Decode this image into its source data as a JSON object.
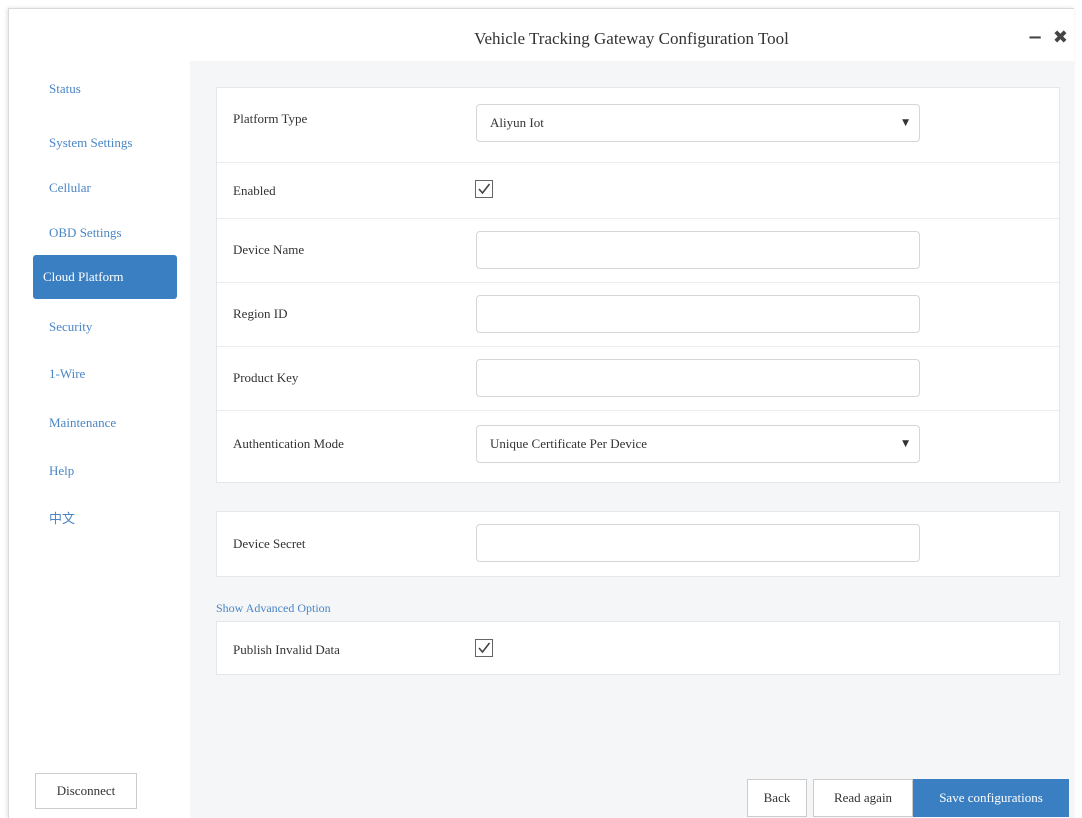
{
  "window": {
    "title": "Vehicle Tracking Gateway Configuration Tool",
    "minimize": "−",
    "close": "✖"
  },
  "sidebar": {
    "items": [
      {
        "label": "Status",
        "active": false
      },
      {
        "label": "System Settings",
        "active": false
      },
      {
        "label": "Cellular",
        "active": false
      },
      {
        "label": "OBD Settings",
        "active": false
      },
      {
        "label": "Cloud Platform",
        "active": true
      },
      {
        "label": "Security",
        "active": false
      },
      {
        "label": "1-Wire",
        "active": false
      },
      {
        "label": "Maintenance",
        "active": false
      },
      {
        "label": "Help",
        "active": false
      },
      {
        "label": "中文",
        "active": false
      }
    ],
    "disconnect_label": "Disconnect"
  },
  "form": {
    "platform_type": {
      "label": "Platform Type",
      "value": "Aliyun Iot"
    },
    "enabled": {
      "label": "Enabled",
      "checked": true
    },
    "device_name": {
      "label": "Device Name",
      "value": ""
    },
    "region_id": {
      "label": "Region ID",
      "value": ""
    },
    "product_key": {
      "label": "Product Key",
      "value": ""
    },
    "auth_mode": {
      "label": "Authentication Mode",
      "value": "Unique Certificate Per Device"
    },
    "device_secret": {
      "label": "Device Secret",
      "value": ""
    },
    "advanced_link": "Show Advanced Option",
    "publish_invalid": {
      "label": "Publish Invalid Data",
      "checked": true
    }
  },
  "actions": {
    "back": "Back",
    "read_again": "Read again",
    "save": "Save configurations"
  },
  "colors": {
    "accent": "#3a7fc1",
    "link": "#4a86c5",
    "content_bg": "#f5f6f7"
  }
}
